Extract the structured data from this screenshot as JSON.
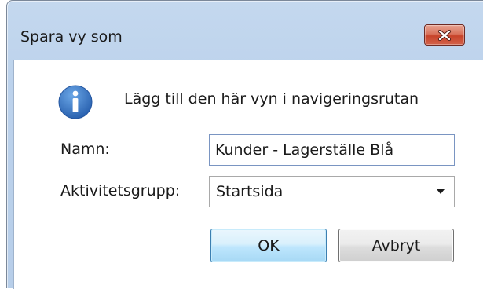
{
  "window": {
    "title": "Spara vy som",
    "close_icon": "close-icon"
  },
  "message": {
    "icon": "info-icon",
    "text": "Lägg till den här vyn i navigeringsrutan"
  },
  "form": {
    "name_label": "Namn:",
    "name_value": "Kunder - Lagerställe Blå",
    "group_label": "Aktivitetsgrupp:",
    "group_value": "Startsida"
  },
  "buttons": {
    "ok": "OK",
    "cancel": "Avbryt"
  },
  "colors": {
    "frame": "#bcd2ec",
    "close_button": "#c7432a",
    "info_icon": "#3a78c4",
    "default_button": "#bee6fd"
  }
}
